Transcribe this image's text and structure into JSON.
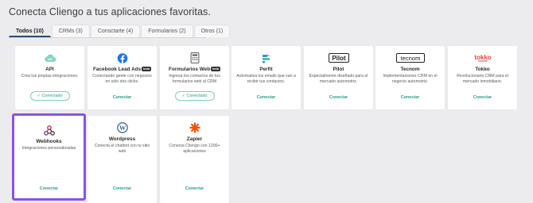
{
  "header": {
    "title": "Conecta Cliengo a tus aplicaciones favoritas."
  },
  "tabs": [
    {
      "label": "Todos (10)",
      "active": true
    },
    {
      "label": "CRMs (3)"
    },
    {
      "label": "Consctarte (4)"
    },
    {
      "label": "Formularios (2)"
    },
    {
      "label": "Otros (1)"
    }
  ],
  "integrations": {
    "api": {
      "name": "API",
      "description": "Crea tus propias integraciones.",
      "action": "Conectado"
    },
    "facebook": {
      "name": "Facebook Lead Ads",
      "badge": "beta",
      "description": "Conectando gente con negocios en sólo dos clicks.",
      "action": "Conectar"
    },
    "formularios": {
      "name": "Formularios Web",
      "badge": "beta",
      "description": "Ingresa los contactos de tus formularios web al CRM",
      "action": "Conectado"
    },
    "perfit": {
      "name": "Perfit",
      "description": "Automatiza los emails que van a recibir tus contactos.",
      "action": "Conectar"
    },
    "pilot": {
      "name": "Pilot",
      "logo_text": "Pilot",
      "description": "Especialmente diseñado para el mercado automotriz.",
      "action": "Conectar"
    },
    "tecnom": {
      "name": "Tecnom",
      "logo_text": "tecnom",
      "description": "Implementaciones CRM en el negocio automotriz.",
      "action": "Conectar"
    },
    "tokko": {
      "name": "Tokko",
      "logo_text": "tokko",
      "description": "Revolucionario CRM para el mercado inmobiliario.",
      "action": "Conectar"
    },
    "webhooks": {
      "name": "Webhooks",
      "description": "Integraciones personalizadas",
      "action": "Conectar"
    },
    "wordpress": {
      "name": "Wordpress",
      "description": "Conecta el chatbot con tu sitio web",
      "action": "Conectar"
    },
    "zapier": {
      "name": "Zapier",
      "description": "Conecta Cliengo con 1200+ aplicaciones",
      "action": "Conectar"
    }
  },
  "colors": {
    "accent": "#2a9d8f",
    "highlight": "#8a52e8",
    "facebook": "#1877f2",
    "zapier": "#ff4a00",
    "tokko": "#e8423a"
  }
}
